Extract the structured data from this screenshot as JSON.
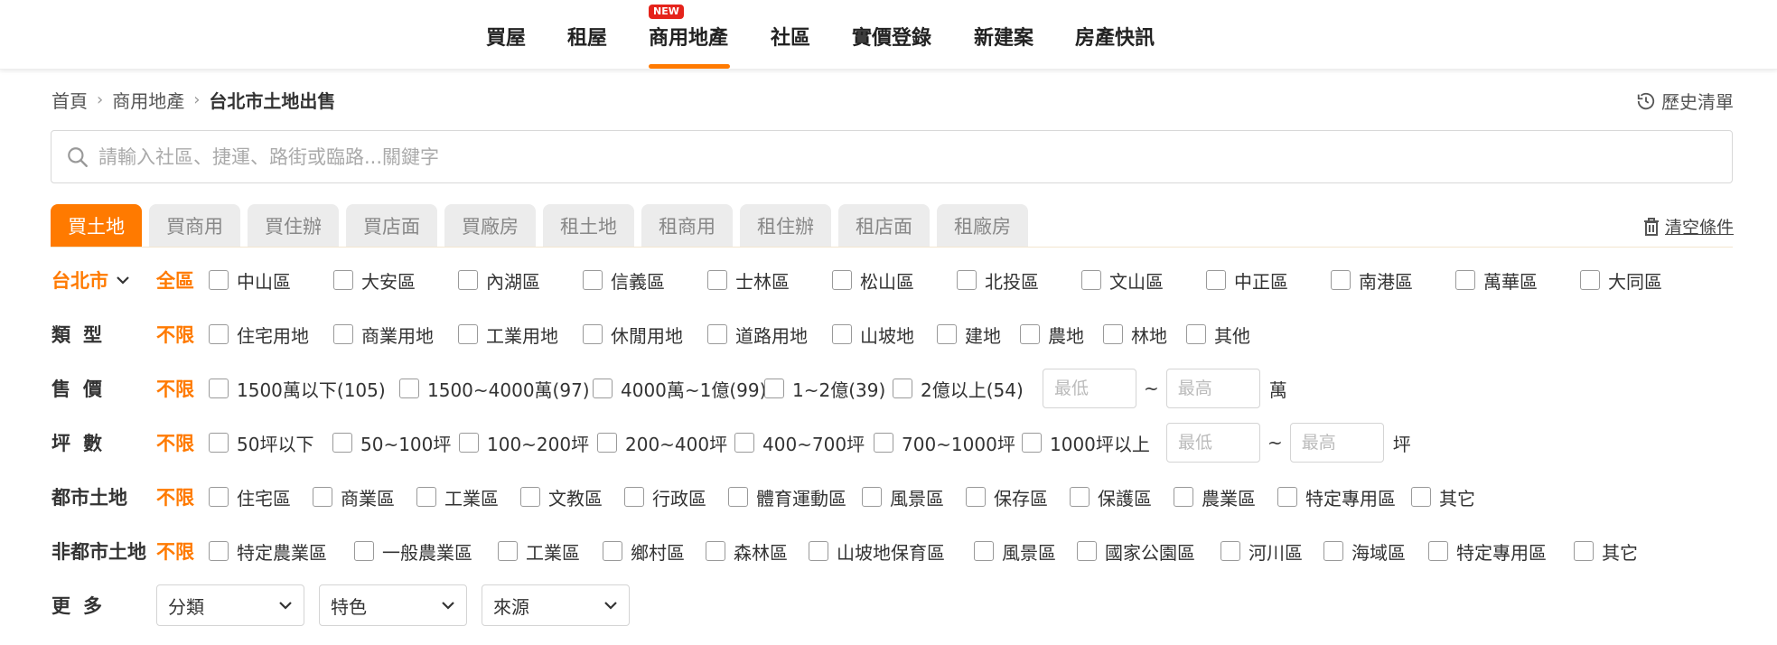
{
  "nav": {
    "items": [
      "買屋",
      "租屋",
      "商用地產",
      "社區",
      "實價登錄",
      "新建案",
      "房產快訊"
    ],
    "new_badge": "NEW"
  },
  "breadcrumb": {
    "home": "首頁",
    "section": "商用地產",
    "current": "台北市土地出售"
  },
  "history_label": "歷史清單",
  "search": {
    "placeholder": "請輸入社區、捷運、路街或臨路...關鍵字"
  },
  "tabs": [
    "買土地",
    "買商用",
    "買住辦",
    "買店面",
    "買廠房",
    "租土地",
    "租商用",
    "租住辦",
    "租店面",
    "租廠房"
  ],
  "clear_label": "清空條件",
  "filters": {
    "district": {
      "city": "台北市",
      "all": "全區",
      "options": [
        "中山區",
        "大安區",
        "內湖區",
        "信義區",
        "士林區",
        "松山區",
        "北投區",
        "文山區",
        "中正區",
        "南港區",
        "萬華區",
        "大同區"
      ]
    },
    "type": {
      "label": "類型",
      "any": "不限",
      "options": [
        "住宅用地",
        "商業用地",
        "工業用地",
        "休閒用地",
        "道路用地",
        "山坡地",
        "建地",
        "農地",
        "林地",
        "其他"
      ]
    },
    "price": {
      "label": "售價",
      "any": "不限",
      "options": [
        "1500萬以下(105)",
        "1500~4000萬(97)",
        "4000萬~1億(99)",
        "1~2億(39)",
        "2億以上(54)"
      ],
      "min_placeholder": "最低",
      "max_placeholder": "最高",
      "tilde": "~",
      "unit": "萬"
    },
    "area": {
      "label": "坪數",
      "any": "不限",
      "options": [
        "50坪以下",
        "50~100坪",
        "100~200坪",
        "200~400坪",
        "400~700坪",
        "700~1000坪",
        "1000坪以上"
      ],
      "min_placeholder": "最低",
      "max_placeholder": "最高",
      "tilde": "~",
      "unit": "坪"
    },
    "urban": {
      "label": "都市土地",
      "any": "不限",
      "options": [
        "住宅區",
        "商業區",
        "工業區",
        "文教區",
        "行政區",
        "體育運動區",
        "風景區",
        "保存區",
        "保護區",
        "農業區",
        "特定專用區",
        "其它"
      ]
    },
    "nonurban": {
      "label": "非都市土地",
      "any": "不限",
      "options": [
        "特定農業區",
        "一般農業區",
        "工業區",
        "鄉村區",
        "森林區",
        "山坡地保育區",
        "風景區",
        "國家公園區",
        "河川區",
        "海域區",
        "特定專用區",
        "其它"
      ]
    },
    "more": {
      "label": "更多",
      "selects": [
        "分類",
        "特色",
        "來源"
      ]
    }
  },
  "colors": {
    "accent": "#ff7a00",
    "badge": "#e5231b"
  }
}
